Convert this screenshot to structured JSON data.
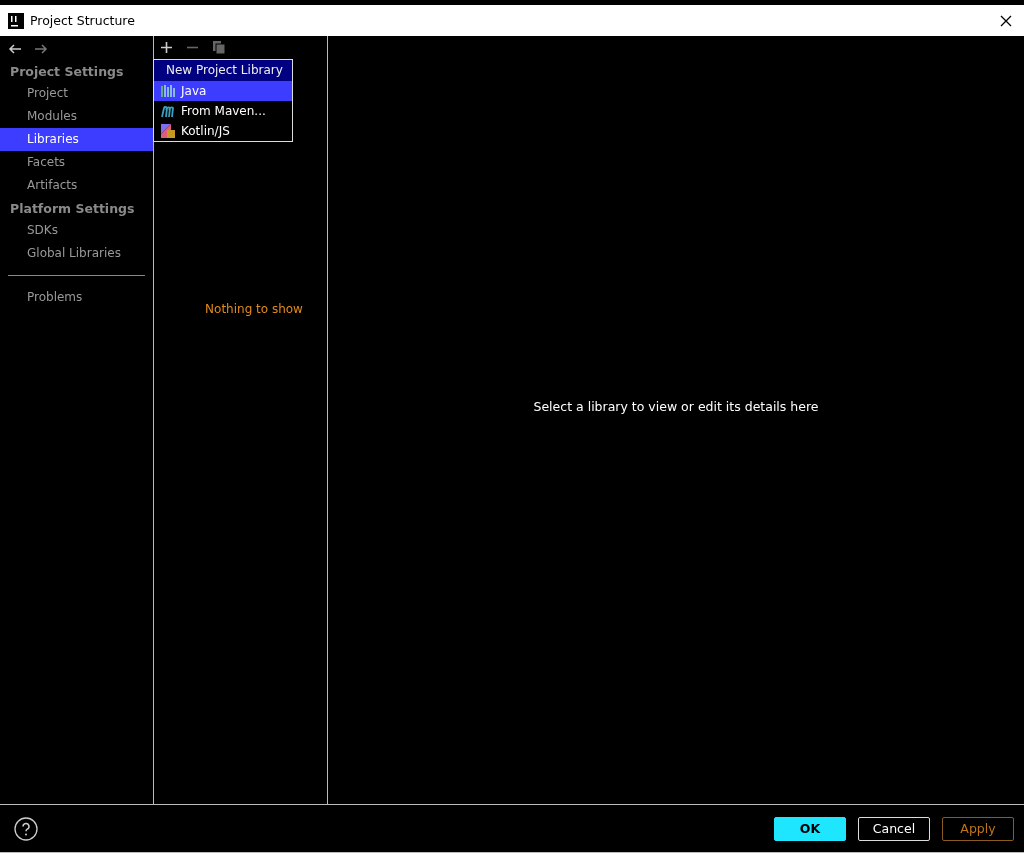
{
  "window": {
    "title": "Project Structure"
  },
  "sidebar": {
    "items": [
      {
        "kind": "header",
        "label": "Project Settings"
      },
      {
        "kind": "item",
        "label": "Project",
        "selected": false
      },
      {
        "kind": "item",
        "label": "Modules",
        "selected": false
      },
      {
        "kind": "item",
        "label": "Libraries",
        "selected": true
      },
      {
        "kind": "item",
        "label": "Facets",
        "selected": false
      },
      {
        "kind": "item",
        "label": "Artifacts",
        "selected": false
      },
      {
        "kind": "header",
        "label": "Platform Settings"
      },
      {
        "kind": "item",
        "label": "SDKs",
        "selected": false
      },
      {
        "kind": "item",
        "label": "Global Libraries",
        "selected": false
      },
      {
        "kind": "separator"
      },
      {
        "kind": "item",
        "label": "Problems",
        "selected": false
      }
    ]
  },
  "libraries_panel": {
    "empty_text": "Nothing to show",
    "popup": {
      "title": "New Project Library",
      "items": [
        {
          "label": "Java",
          "selected": true
        },
        {
          "label": "From Maven...",
          "selected": false
        },
        {
          "label": "Kotlin/JS",
          "selected": false
        }
      ]
    }
  },
  "details": {
    "text": "Select a library to view or edit its details here"
  },
  "buttons": [
    {
      "label": "OK",
      "kind": "primary"
    },
    {
      "label": "Cancel",
      "kind": "normal"
    },
    {
      "label": "Apply",
      "kind": "disabled"
    }
  ]
}
